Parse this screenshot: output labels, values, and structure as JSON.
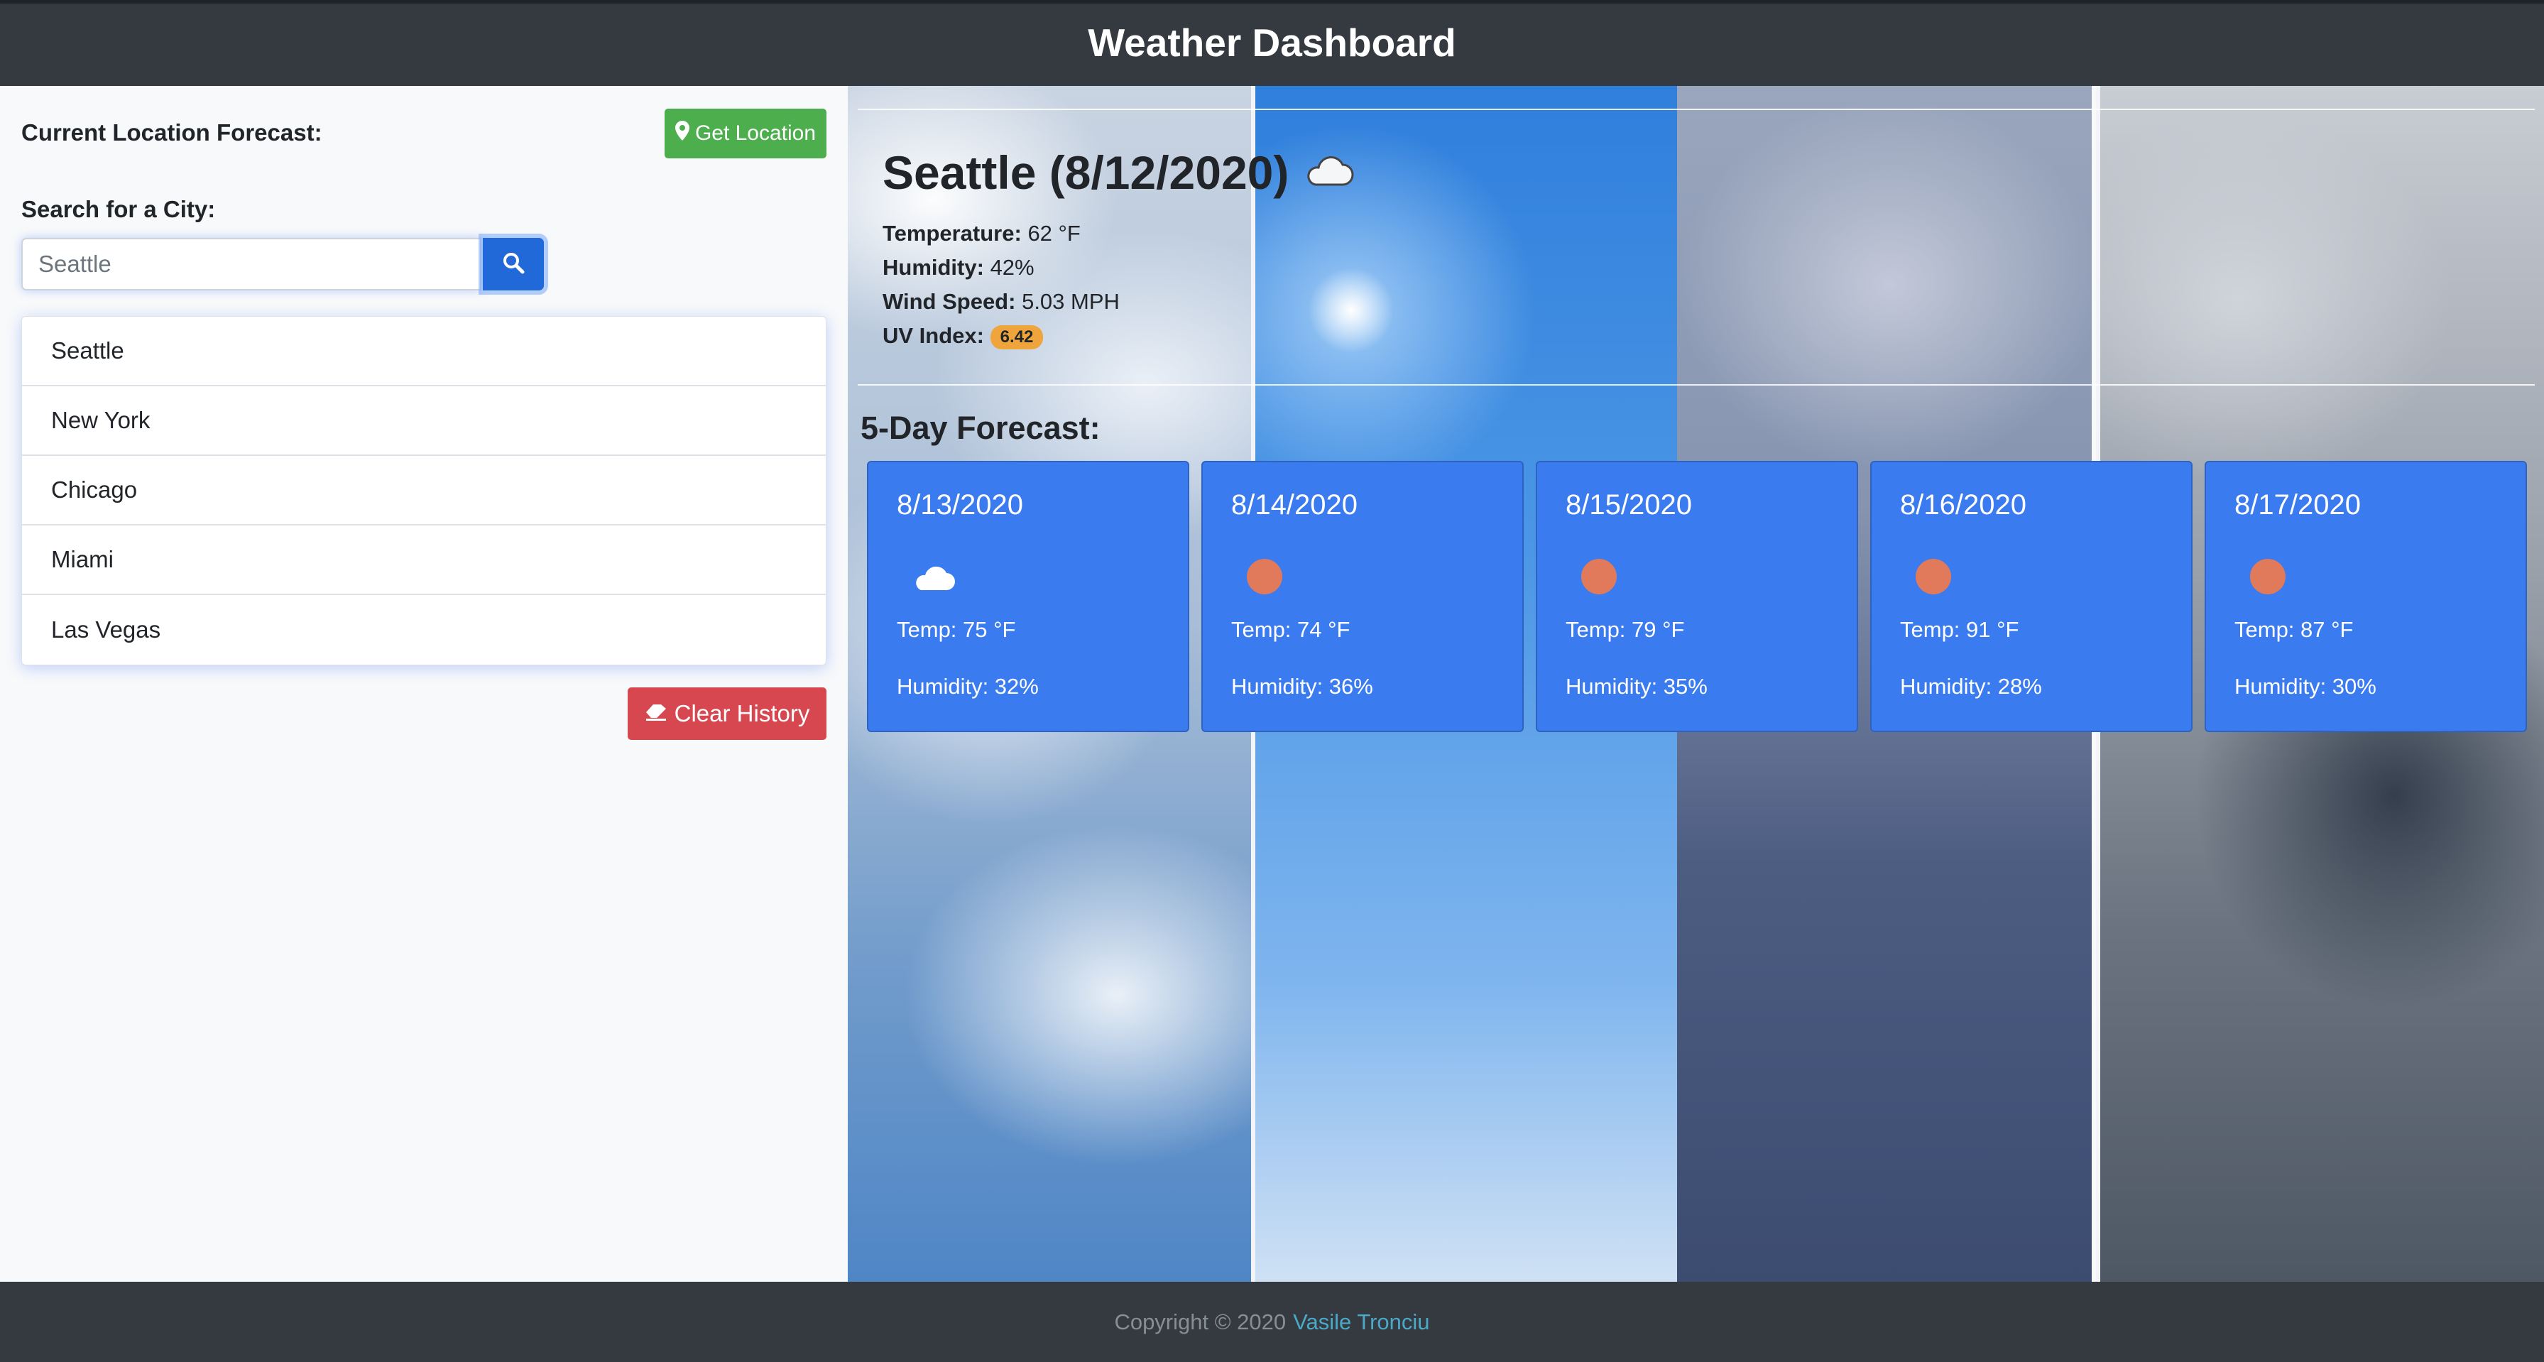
{
  "header": {
    "title": "Weather Dashboard"
  },
  "sidebar": {
    "current_location_label": "Current Location Forecast:",
    "get_location_label": "Get Location",
    "search_label": "Search for a City:",
    "search_placeholder": "Seattle",
    "history": [
      "Seattle",
      "New York",
      "Chicago",
      "Miami",
      "Las Vegas"
    ],
    "clear_history_label": "Clear History"
  },
  "current": {
    "title": "Seattle (8/12/2020)",
    "icon": "cloud-icon",
    "temperature_label": "Temperature:",
    "temperature": "62 °F",
    "humidity_label": "Humidity:",
    "humidity": "42%",
    "wind_label": "Wind Speed:",
    "wind": "5.03 MPH",
    "uv_label": "UV Index:",
    "uv": "6.42",
    "uv_color": "#f0a53c"
  },
  "forecast": {
    "title": "5-Day Forecast:",
    "days": [
      {
        "date": "8/13/2020",
        "icon": "cloud-icon",
        "temp": "Temp: 75 °F",
        "humidity": "Humidity: 32%"
      },
      {
        "date": "8/14/2020",
        "icon": "sun-icon",
        "temp": "Temp: 74 °F",
        "humidity": "Humidity: 36%"
      },
      {
        "date": "8/15/2020",
        "icon": "sun-icon",
        "temp": "Temp: 79 °F",
        "humidity": "Humidity: 35%"
      },
      {
        "date": "8/16/2020",
        "icon": "sun-icon",
        "temp": "Temp: 91 °F",
        "humidity": "Humidity: 28%"
      },
      {
        "date": "8/17/2020",
        "icon": "sun-icon",
        "temp": "Temp: 87 °F",
        "humidity": "Humidity: 30%"
      }
    ]
  },
  "footer": {
    "copyright": "Copyright © 2020",
    "author": "Vasile Tronciu"
  },
  "colors": {
    "header_bg": "#343a40",
    "card_bg": "#3a7bf0",
    "success": "#4cae4c",
    "danger": "#d7474f",
    "primary": "#2168d8"
  }
}
